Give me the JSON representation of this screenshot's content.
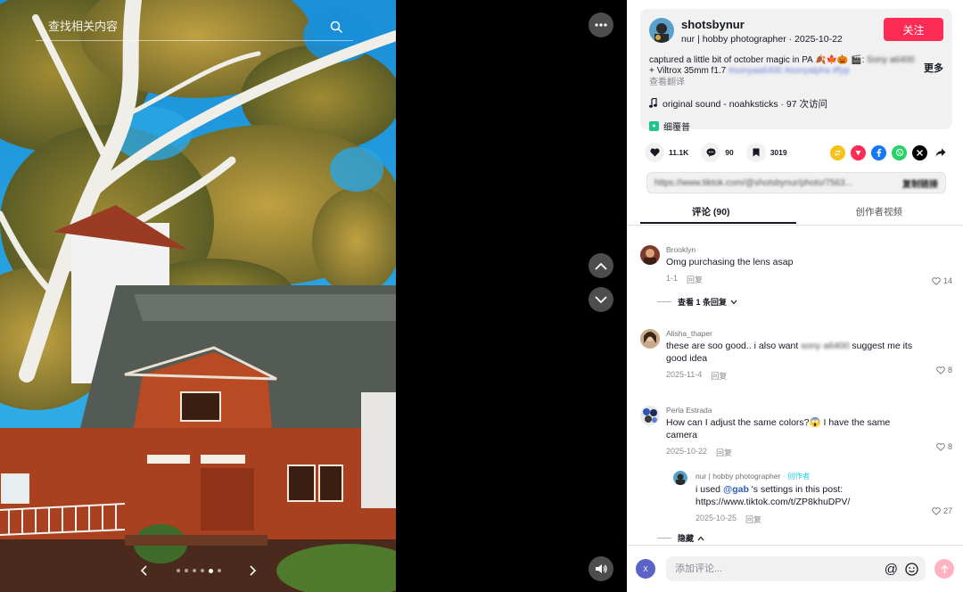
{
  "search": {
    "placeholder": "查找相关内容"
  },
  "media": {
    "pager": {
      "total_dots": 6,
      "active_dot": 5
    }
  },
  "post": {
    "author_name": "shotsbynur",
    "author_meta": "nur | hobby photographer · 2025-10-22",
    "follow_label": "关注",
    "caption_visible": "captured a little bit of october magic in PA 🍂🍁🎃 🎬:",
    "caption_lens": "+ Viltrox 35mm f1.7",
    "more_label": "更多",
    "translate_label": "查看翻译",
    "music": "original sound - noahksticks · 97 次访问",
    "tag_label": "细覆普"
  },
  "actions": {
    "likes": "11.1K",
    "comments": "90",
    "saves": "3019"
  },
  "link": {
    "url": "https://www.tiktok.com/@shotsbynur/photo/7563..."
  },
  "tabs": {
    "comments": "评论 (90)",
    "creator_videos": "创作者视频"
  },
  "comments": [
    {
      "user": "Brooklyn",
      "text": "Omg purchasing the lens asap",
      "date": "1-1",
      "reply_label": "回复",
      "likes": "14",
      "view_replies": "查看 1 条回复"
    },
    {
      "user": "Alisha_thaper",
      "text_a": "these are soo good.. i also want",
      "text_b": "suggest me its good idea",
      "date": "2025-11-4",
      "reply_label": "回复",
      "likes": "8"
    },
    {
      "user": "Perla Estrada",
      "text": "How can I adjust the same colors?😱 I have the same camera",
      "date": "2025-10-22",
      "reply_label": "回复",
      "likes": "8",
      "reply": {
        "user": "nur | hobby photographer",
        "creator_label": "· 创作者",
        "text_a": "i used",
        "mention": "@gab",
        "text_b": "'s settings in this post: https://www.tiktok.com/t/ZP8khuDPV/",
        "date": "2025-10-25",
        "reply_label": "回复",
        "likes": "27"
      },
      "hide_label": "隐藏"
    }
  ],
  "composer": {
    "avatar_letter": "X",
    "placeholder": "添加评论..."
  },
  "colors": {
    "accent": "#fe2c55",
    "panel_bg": "#ffffff",
    "card_bg": "#f1f1f2"
  }
}
